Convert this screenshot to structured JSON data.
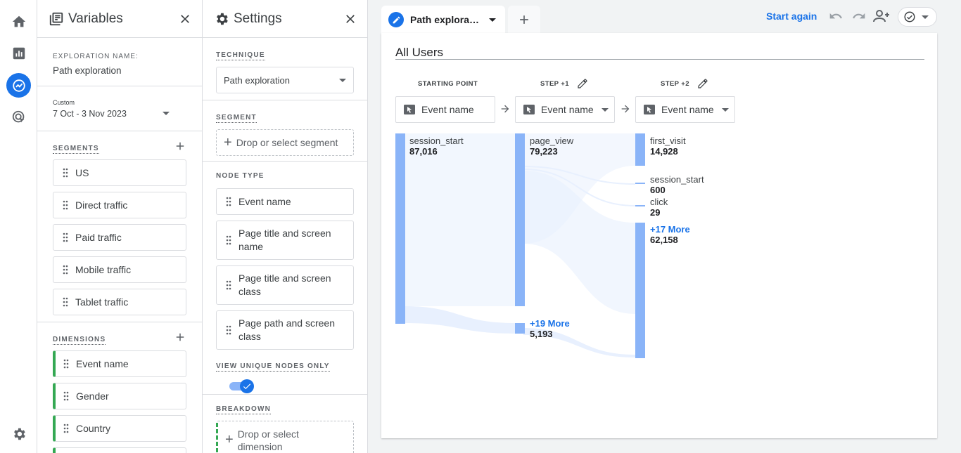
{
  "rail": {
    "items": [
      {
        "icon": "home-icon"
      },
      {
        "icon": "reports-icon"
      },
      {
        "icon": "explore-icon",
        "active": true
      },
      {
        "icon": "advertising-icon"
      }
    ],
    "settings_icon": "gear-icon"
  },
  "variables": {
    "title": "Variables",
    "exploration_name_label": "EXPLORATION NAME:",
    "exploration_name": "Path exploration",
    "date_range_label": "Custom",
    "date_range": "7 Oct - 3 Nov 2023",
    "segments_label": "SEGMENTS",
    "segments": [
      "US",
      "Direct traffic",
      "Paid traffic",
      "Mobile traffic",
      "Tablet traffic"
    ],
    "dimensions_label": "DIMENSIONS",
    "dimensions": [
      "Event name",
      "Gender",
      "Country"
    ]
  },
  "settings": {
    "title": "Settings",
    "technique_label": "TECHNIQUE",
    "technique": "Path exploration",
    "segment_label": "SEGMENT",
    "segment_placeholder": "Drop or select segment",
    "node_type_label": "NODE TYPE",
    "node_types": [
      "Event name",
      "Page title and screen name",
      "Page title and screen class",
      "Page path and screen class"
    ],
    "unique_nodes_label": "VIEW UNIQUE NODES ONLY",
    "unique_nodes_on": true,
    "breakdown_label": "BREAKDOWN",
    "breakdown_placeholder": "Drop or select dimension"
  },
  "toolbar": {
    "tab_title": "Path exploration",
    "start_again": "Start again"
  },
  "canvas": {
    "segment_title": "All Users",
    "steps": [
      {
        "label": "STARTING POINT",
        "node": "Event name"
      },
      {
        "label": "STEP +1",
        "node": "Event name"
      },
      {
        "label": "STEP +2",
        "node": "Event name"
      }
    ],
    "nodes": {
      "s0_session_start": {
        "name": "session_start",
        "value": "87,016"
      },
      "s1_page_view": {
        "name": "page_view",
        "value": "79,223"
      },
      "s1_more": {
        "name": "+19 More",
        "value": "5,193"
      },
      "s2_first_visit": {
        "name": "first_visit",
        "value": "14,928"
      },
      "s2_session_start": {
        "name": "session_start",
        "value": "600"
      },
      "s2_click": {
        "name": "click",
        "value": "29"
      },
      "s2_more": {
        "name": "+17 More",
        "value": "62,158"
      }
    }
  },
  "colors": {
    "accent": "#1a73e8",
    "node": "#8ab4f8",
    "dimension": "#34a853"
  }
}
